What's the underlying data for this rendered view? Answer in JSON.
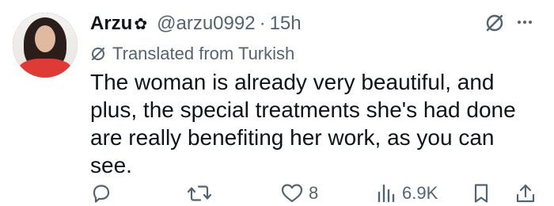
{
  "tweet": {
    "display_name": "Arzu",
    "name_badge_icon": "flower-icon",
    "handle": "@arzu0992",
    "separator": "·",
    "time": "15h",
    "translated_label": "Translated from Turkish",
    "text": "The woman is already very beautiful, and plus, the special treatments she's had done are really benefiting her work, as you can see."
  },
  "actions": {
    "reply_icon": "reply-icon",
    "retweet_icon": "retweet-icon",
    "like_icon": "heart-icon",
    "like_count": "8",
    "views_icon": "views-icon",
    "views_count": "6.9K",
    "bookmark_icon": "bookmark-icon",
    "share_icon": "share-icon"
  },
  "colors": {
    "text": "#0f1419",
    "secondary": "#536471",
    "background": "#ffffff"
  }
}
